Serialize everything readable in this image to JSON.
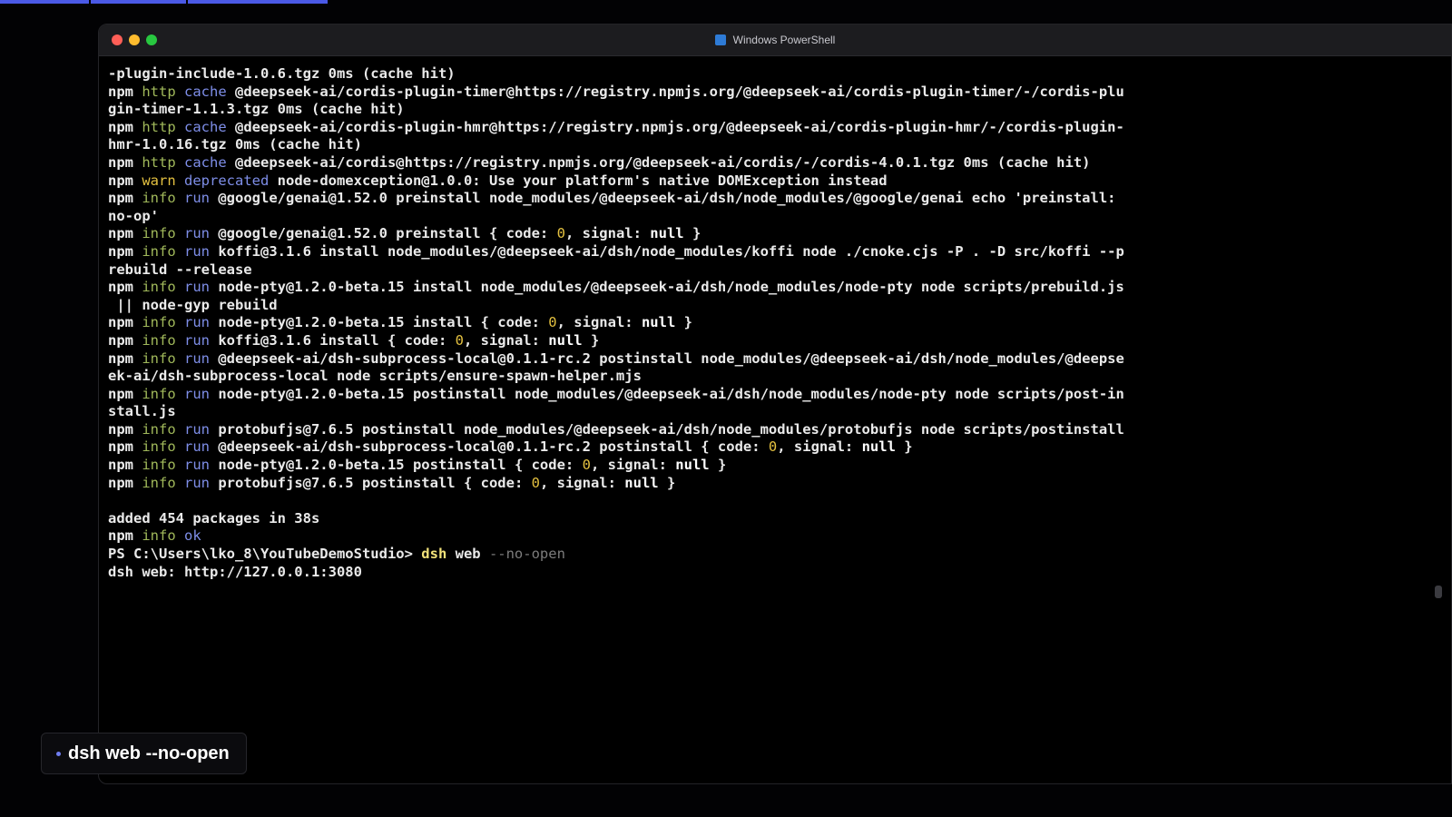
{
  "window": {
    "title": "Windows PowerShell"
  },
  "colors": {
    "accent": "#4a59e6",
    "npm_keyword_green": "#a0b85a",
    "npm_keyword_blue": "#7e8ee8",
    "number_yellow": "#e3c040",
    "close": "#ff5f57",
    "minimize": "#febc2e",
    "zoom": "#28c840"
  },
  "icons": {
    "window_icon": "powershell-icon"
  },
  "terminal": {
    "lines": [
      [
        {
          "c": "white",
          "t": "-plugin-include-1.0.6.tgz 0ms (cache hit)"
        }
      ],
      [
        {
          "c": "npm",
          "t": "npm "
        },
        {
          "c": "green",
          "t": "http "
        },
        {
          "c": "blue",
          "t": "cache "
        },
        {
          "c": "white",
          "t": "@deepseek-ai/cordis-plugin-timer@https://registry.npmjs.org/@deepseek-ai/cordis-plugin-timer/-/cordis-plu"
        }
      ],
      [
        {
          "c": "white",
          "t": "gin-timer-1.1.3.tgz 0ms (cache hit)"
        }
      ],
      [
        {
          "c": "npm",
          "t": "npm "
        },
        {
          "c": "green",
          "t": "http "
        },
        {
          "c": "blue",
          "t": "cache "
        },
        {
          "c": "white",
          "t": "@deepseek-ai/cordis-plugin-hmr@https://registry.npmjs.org/@deepseek-ai/cordis-plugin-hmr/-/cordis-plugin-"
        }
      ],
      [
        {
          "c": "white",
          "t": "hmr-1.0.16.tgz 0ms (cache hit)"
        }
      ],
      [
        {
          "c": "npm",
          "t": "npm "
        },
        {
          "c": "green",
          "t": "http "
        },
        {
          "c": "blue",
          "t": "cache "
        },
        {
          "c": "white",
          "t": "@deepseek-ai/cordis@https://registry.npmjs.org/@deepseek-ai/cordis/-/cordis-4.0.1.tgz 0ms (cache hit)"
        }
      ],
      [
        {
          "c": "npm",
          "t": "npm "
        },
        {
          "c": "yellow",
          "t": "warn "
        },
        {
          "c": "blue",
          "t": "deprecated "
        },
        {
          "c": "white",
          "t": "node-domexception@1.0.0: Use your platform's native DOMException instead"
        }
      ],
      [
        {
          "c": "npm",
          "t": "npm "
        },
        {
          "c": "green",
          "t": "info "
        },
        {
          "c": "blue",
          "t": "run "
        },
        {
          "c": "white",
          "t": "@google/genai@1.52.0 preinstall node_modules/@deepseek-ai/dsh/node_modules/@google/genai echo 'preinstall:"
        }
      ],
      [
        {
          "c": "white",
          "t": "no-op'"
        }
      ],
      [
        {
          "c": "npm",
          "t": "npm "
        },
        {
          "c": "green",
          "t": "info "
        },
        {
          "c": "blue",
          "t": "run "
        },
        {
          "c": "white",
          "t": "@google/genai@1.52.0 preinstall { code: "
        },
        {
          "c": "yellow",
          "t": "0"
        },
        {
          "c": "white",
          "t": ", signal: "
        },
        {
          "c": "bold",
          "t": "null"
        },
        {
          "c": "white",
          "t": " }"
        }
      ],
      [
        {
          "c": "npm",
          "t": "npm "
        },
        {
          "c": "green",
          "t": "info "
        },
        {
          "c": "blue",
          "t": "run "
        },
        {
          "c": "white",
          "t": "koffi@3.1.6 install node_modules/@deepseek-ai/dsh/node_modules/koffi node ./cnoke.cjs -P . -D src/koffi --p"
        }
      ],
      [
        {
          "c": "white",
          "t": "rebuild --release"
        }
      ],
      [
        {
          "c": "npm",
          "t": "npm "
        },
        {
          "c": "green",
          "t": "info "
        },
        {
          "c": "blue",
          "t": "run "
        },
        {
          "c": "white",
          "t": "node-pty@1.2.0-beta.15 install node_modules/@deepseek-ai/dsh/node_modules/node-pty node scripts/prebuild.js"
        }
      ],
      [
        {
          "c": "white",
          "t": " || node-gyp rebuild"
        }
      ],
      [
        {
          "c": "npm",
          "t": "npm "
        },
        {
          "c": "green",
          "t": "info "
        },
        {
          "c": "blue",
          "t": "run "
        },
        {
          "c": "white",
          "t": "node-pty@1.2.0-beta.15 install { code: "
        },
        {
          "c": "yellow",
          "t": "0"
        },
        {
          "c": "white",
          "t": ", signal: "
        },
        {
          "c": "bold",
          "t": "null"
        },
        {
          "c": "white",
          "t": " }"
        }
      ],
      [
        {
          "c": "npm",
          "t": "npm "
        },
        {
          "c": "green",
          "t": "info "
        },
        {
          "c": "blue",
          "t": "run "
        },
        {
          "c": "white",
          "t": "koffi@3.1.6 install { code: "
        },
        {
          "c": "yellow",
          "t": "0"
        },
        {
          "c": "white",
          "t": ", signal: "
        },
        {
          "c": "bold",
          "t": "null"
        },
        {
          "c": "white",
          "t": " }"
        }
      ],
      [
        {
          "c": "npm",
          "t": "npm "
        },
        {
          "c": "green",
          "t": "info "
        },
        {
          "c": "blue",
          "t": "run "
        },
        {
          "c": "white",
          "t": "@deepseek-ai/dsh-subprocess-local@0.1.1-rc.2 postinstall node_modules/@deepseek-ai/dsh/node_modules/@deepse"
        }
      ],
      [
        {
          "c": "white",
          "t": "ek-ai/dsh-subprocess-local node scripts/ensure-spawn-helper.mjs"
        }
      ],
      [
        {
          "c": "npm",
          "t": "npm "
        },
        {
          "c": "green",
          "t": "info "
        },
        {
          "c": "blue",
          "t": "run "
        },
        {
          "c": "white",
          "t": "node-pty@1.2.0-beta.15 postinstall node_modules/@deepseek-ai/dsh/node_modules/node-pty node scripts/post-in"
        }
      ],
      [
        {
          "c": "white",
          "t": "stall.js"
        }
      ],
      [
        {
          "c": "npm",
          "t": "npm "
        },
        {
          "c": "green",
          "t": "info "
        },
        {
          "c": "blue",
          "t": "run "
        },
        {
          "c": "white",
          "t": "protobufjs@7.6.5 postinstall node_modules/@deepseek-ai/dsh/node_modules/protobufjs node scripts/postinstall"
        }
      ],
      [
        {
          "c": "npm",
          "t": "npm "
        },
        {
          "c": "green",
          "t": "info "
        },
        {
          "c": "blue",
          "t": "run "
        },
        {
          "c": "white",
          "t": "@deepseek-ai/dsh-subprocess-local@0.1.1-rc.2 postinstall { code: "
        },
        {
          "c": "yellow",
          "t": "0"
        },
        {
          "c": "white",
          "t": ", signal: "
        },
        {
          "c": "bold",
          "t": "null"
        },
        {
          "c": "white",
          "t": " }"
        }
      ],
      [
        {
          "c": "npm",
          "t": "npm "
        },
        {
          "c": "green",
          "t": "info "
        },
        {
          "c": "blue",
          "t": "run "
        },
        {
          "c": "white",
          "t": "node-pty@1.2.0-beta.15 postinstall { code: "
        },
        {
          "c": "yellow",
          "t": "0"
        },
        {
          "c": "white",
          "t": ", signal: "
        },
        {
          "c": "bold",
          "t": "null"
        },
        {
          "c": "white",
          "t": " }"
        }
      ],
      [
        {
          "c": "npm",
          "t": "npm "
        },
        {
          "c": "green",
          "t": "info "
        },
        {
          "c": "blue",
          "t": "run "
        },
        {
          "c": "white",
          "t": "protobufjs@7.6.5 postinstall { code: "
        },
        {
          "c": "yellow",
          "t": "0"
        },
        {
          "c": "white",
          "t": ", signal: "
        },
        {
          "c": "bold",
          "t": "null"
        },
        {
          "c": "white",
          "t": " }"
        }
      ],
      [],
      [
        {
          "c": "white",
          "t": "added 454 packages in 38s"
        }
      ],
      [
        {
          "c": "npm",
          "t": "npm "
        },
        {
          "c": "green",
          "t": "info "
        },
        {
          "c": "blue",
          "t": "ok"
        }
      ],
      [
        {
          "c": "white",
          "t": "PS C:\\Users\\lko_8\\YouTubeDemoStudio> "
        },
        {
          "c": "cmd",
          "t": "dsh "
        },
        {
          "c": "white",
          "t": "web "
        },
        {
          "c": "dim",
          "t": "--no-open"
        }
      ],
      [
        {
          "c": "white",
          "t": "dsh web: http://127.0.0.1:3080"
        }
      ]
    ]
  },
  "caption": {
    "text": "dsh web --no-open"
  }
}
